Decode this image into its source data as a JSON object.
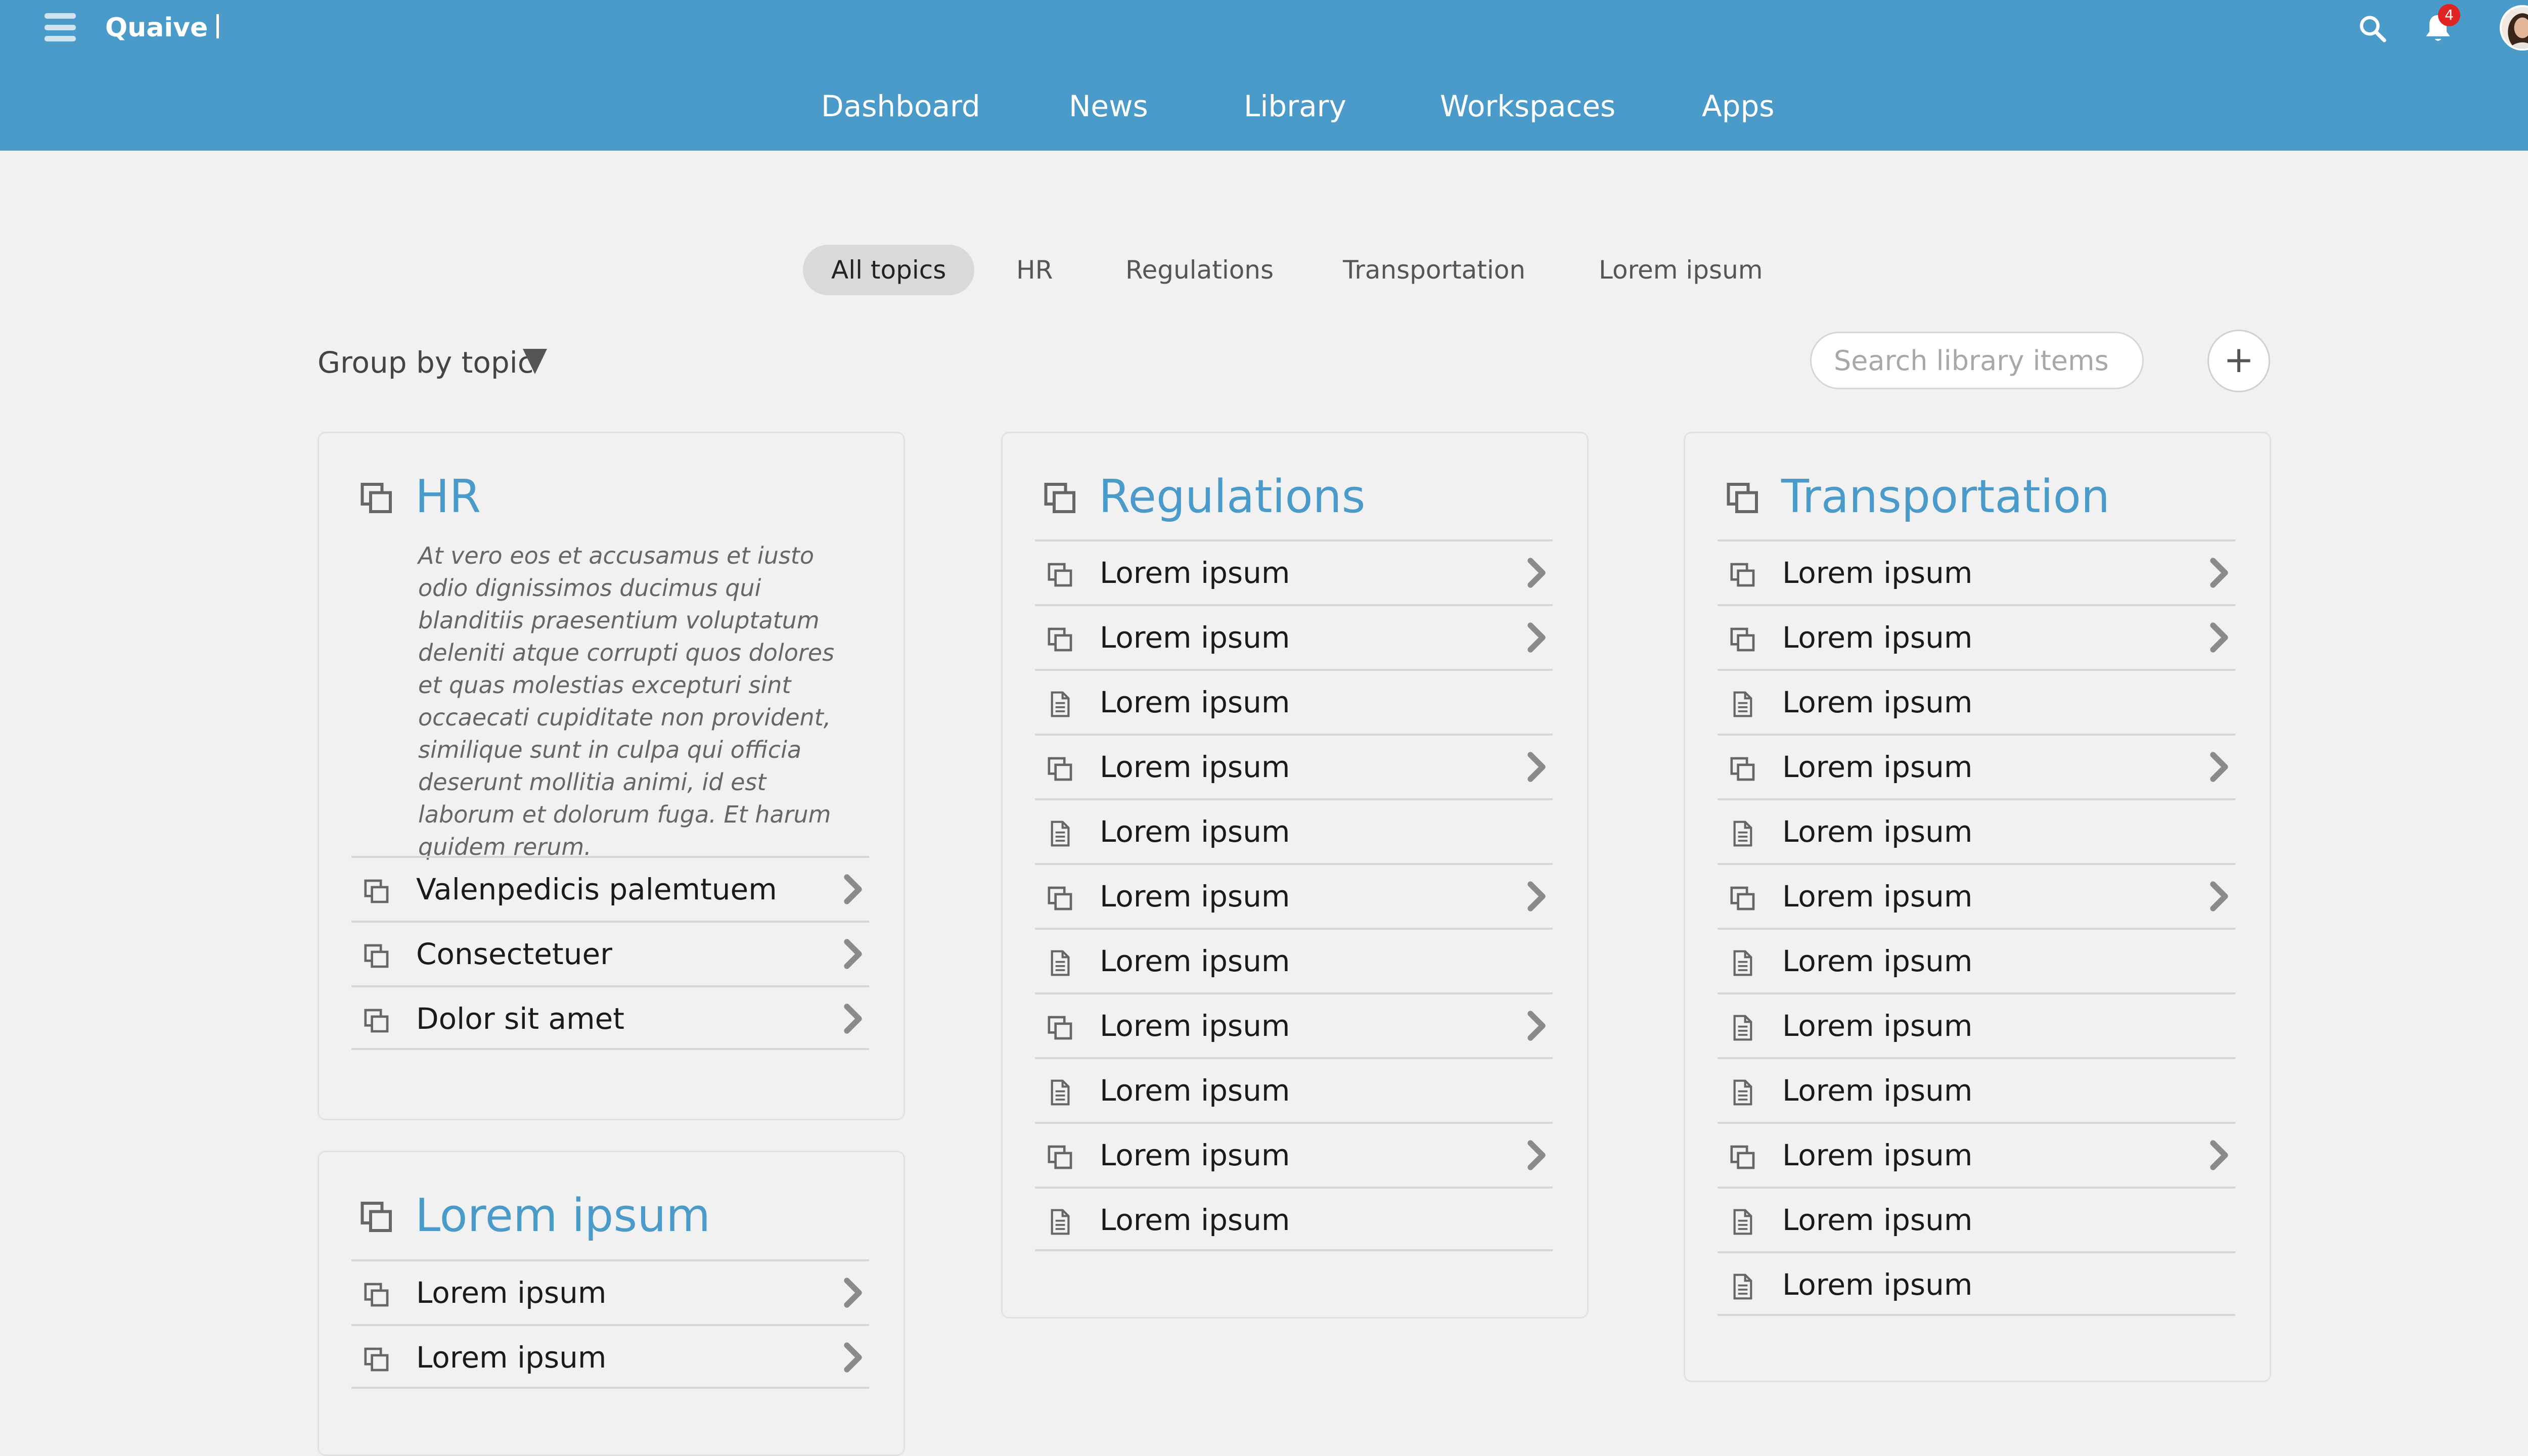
{
  "header": {
    "brand": "Quaive",
    "notification_count": "4",
    "nav": [
      "Dashboard",
      "News",
      "Library",
      "Workspaces",
      "Apps"
    ],
    "icons": [
      "menu-icon",
      "search-icon",
      "bell-icon",
      "avatar"
    ]
  },
  "filters": {
    "topics": [
      "All topics",
      "HR",
      "Regulations",
      "Transportation",
      "Lorem ipsum"
    ],
    "active_topic": "All topics",
    "group_by_label": "Group by topic",
    "search_placeholder": "Search library items",
    "add_label": "+"
  },
  "cards": {
    "hr": {
      "title": "HR",
      "description": "At vero eos et accusamus et iusto odio dignissimos ducimus qui blanditiis praesentium voluptatum deleniti atque corrupti quos dolores et quas molestias excepturi sint occaecati cupiditate non provident, similique sunt in culpa qui officia deserunt mollitia animi, id est laborum et dolorum fuga. Et harum quidem rerum.",
      "items": [
        {
          "label": "Valenpedicis palemtuem",
          "type": "folder"
        },
        {
          "label": "Consectetuer",
          "type": "folder"
        },
        {
          "label": "Dolor sit amet",
          "type": "folder"
        }
      ]
    },
    "lorem": {
      "title": "Lorem ipsum",
      "items": [
        {
          "label": "Lorem ipsum",
          "type": "folder"
        },
        {
          "label": "Lorem ipsum",
          "type": "folder"
        }
      ]
    },
    "regulations": {
      "title": "Regulations",
      "items": [
        {
          "label": "Lorem ipsum",
          "type": "folder"
        },
        {
          "label": "Lorem ipsum",
          "type": "folder"
        },
        {
          "label": "Lorem ipsum",
          "type": "document"
        },
        {
          "label": "Lorem ipsum",
          "type": "folder"
        },
        {
          "label": "Lorem ipsum",
          "type": "document"
        },
        {
          "label": "Lorem ipsum",
          "type": "folder"
        },
        {
          "label": "Lorem ipsum",
          "type": "document"
        },
        {
          "label": "Lorem ipsum",
          "type": "folder"
        },
        {
          "label": "Lorem ipsum",
          "type": "document"
        },
        {
          "label": "Lorem ipsum",
          "type": "folder"
        },
        {
          "label": "Lorem ipsum",
          "type": "document"
        }
      ]
    },
    "transportation": {
      "title": "Transportation",
      "items": [
        {
          "label": "Lorem ipsum",
          "type": "folder"
        },
        {
          "label": "Lorem ipsum",
          "type": "folder"
        },
        {
          "label": "Lorem ipsum",
          "type": "document"
        },
        {
          "label": "Lorem ipsum",
          "type": "folder"
        },
        {
          "label": "Lorem ipsum",
          "type": "document"
        },
        {
          "label": "Lorem ipsum",
          "type": "folder"
        },
        {
          "label": "Lorem ipsum",
          "type": "document"
        },
        {
          "label": "Lorem ipsum",
          "type": "document"
        },
        {
          "label": "Lorem ipsum",
          "type": "document"
        },
        {
          "label": "Lorem ipsum",
          "type": "folder"
        },
        {
          "label": "Lorem ipsum",
          "type": "document"
        },
        {
          "label": "Lorem ipsum",
          "type": "document"
        }
      ]
    }
  },
  "colors": {
    "header_bg": "#4a9bc9",
    "accent": "#4a9bc9",
    "badge": "#e02424",
    "page_bg": "#f1f1f1"
  }
}
